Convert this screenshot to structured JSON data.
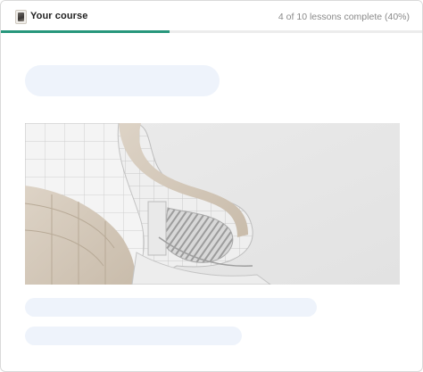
{
  "header": {
    "course_title": "Your course",
    "progress_text": "4 of 10 lessons complete (40%)",
    "progress_fraction": 0.4,
    "progress_color": "#27977c"
  },
  "content": {
    "title_placeholder": "loading",
    "image_icon": "architecture-photo",
    "body_placeholders": 2
  }
}
